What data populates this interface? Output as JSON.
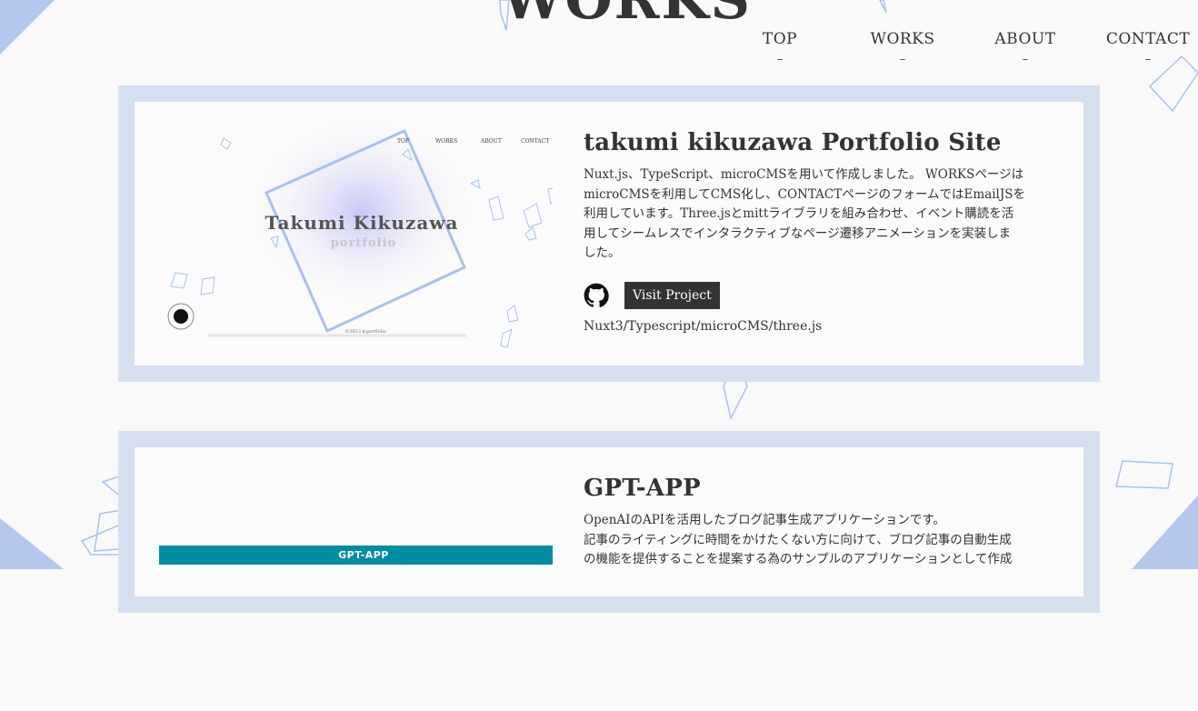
{
  "page": {
    "title": "WORKS",
    "colors": {
      "background": "#f9f9fa",
      "card_border": "#d6dff0",
      "accent_blue": "#a9c1ec",
      "text": "#333333",
      "gpt_bar": "#008ca1"
    }
  },
  "nav": {
    "items": [
      {
        "label": "TOP",
        "dash": "–"
      },
      {
        "label": "WORKS",
        "dash": "–"
      },
      {
        "label": "ABOUT",
        "dash": "–"
      },
      {
        "label": "CONTACT",
        "dash": "–"
      }
    ]
  },
  "works": [
    {
      "title": "takumi kikuzawa Portfolio Site",
      "description": "Nuxt.js、TypeScript、microCMSを用いて作成しました。 WORKSページは\nmicroCMSを利用してCMS化し、CONTACTページのフォームではEmailJSを\n利用しています。Three.jsとmittライブラリを組み合わせ、イベント購読を活\n用してシームレスでインタラクティブなページ遷移アニメーションを実装しま\nした。",
      "github_icon": "github-icon",
      "visit_label": "Visit Project",
      "tech": "Nuxt3/Typescript/microCMS/three.js",
      "thumbnail": {
        "heading": "Takumi Kikuzawa",
        "subheading": "portfolio",
        "nav": [
          "TOP",
          "WORKS",
          "ABOUT",
          "CONTACT"
        ],
        "footer": "©2023 k-portfolio"
      }
    },
    {
      "title": "GPT-APP",
      "description": "OpenAIのAPIを活用したブログ記事生成アプリケーションです。\n記事のライティングに時間をかけたくない方に向けて、ブログ記事の自動生成\nの機能を提供することを提案する為のサンプルのアプリケーションとして作成",
      "thumbnail": {
        "bar_label": "GPT-APP"
      }
    }
  ]
}
